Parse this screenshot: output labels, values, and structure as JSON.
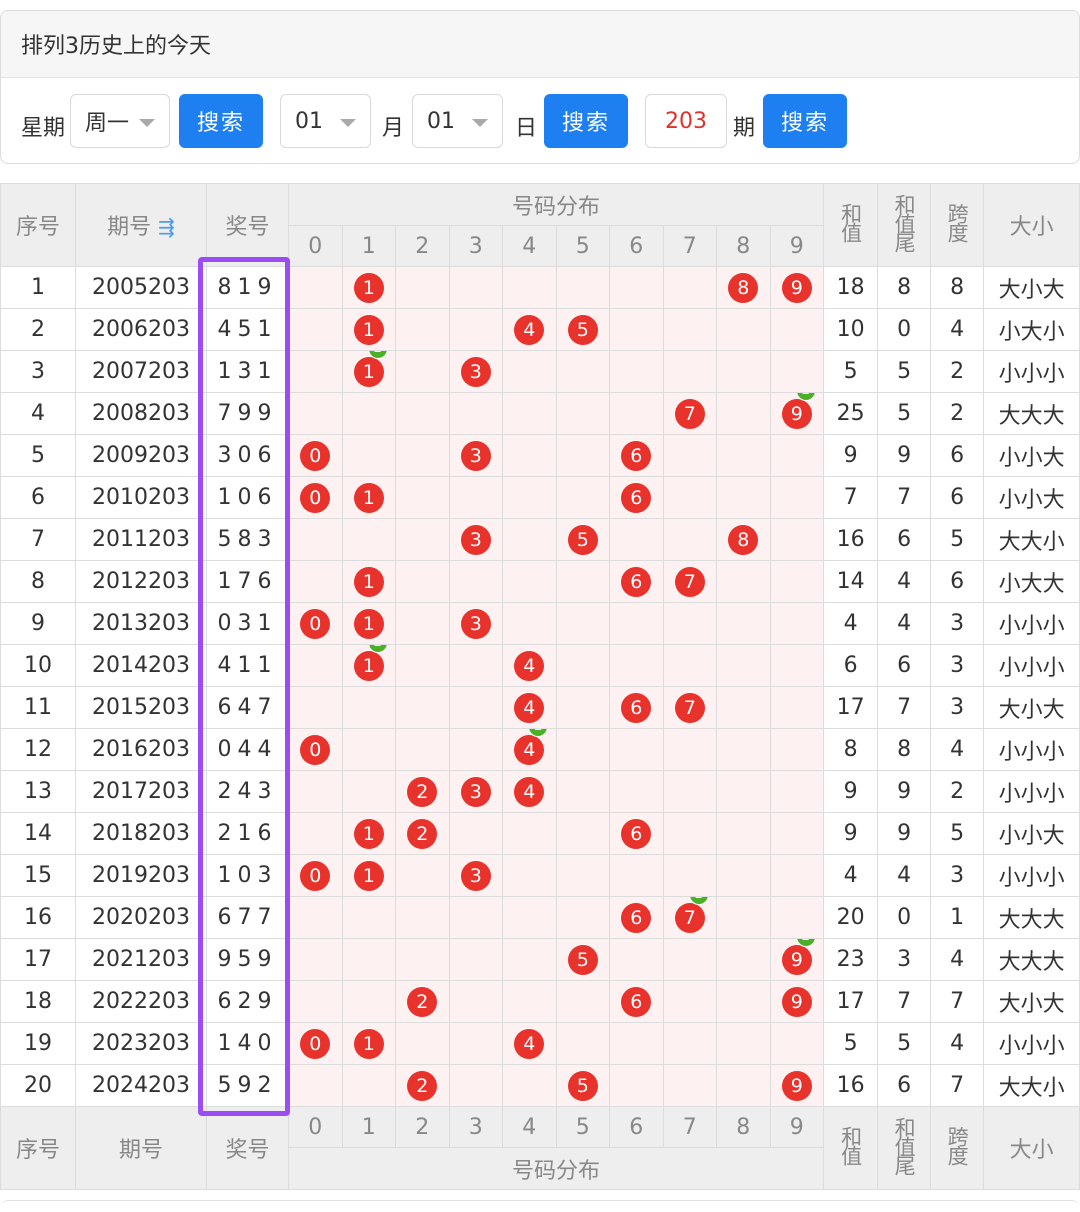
{
  "panel": {
    "title": "排列3历史上的今天",
    "week_label": "星期",
    "week_value": "周一",
    "month_value": "01",
    "month_label": "月",
    "day_value": "01",
    "day_label": "日",
    "issue_value": "203",
    "issue_label": "期",
    "search_label": "搜索"
  },
  "table": {
    "headers": {
      "index": "序号",
      "period": "期号",
      "prize": "奖号",
      "distribution": "号码分布",
      "sum": "和值",
      "sum_tail": "和值尾",
      "span": "跨度",
      "size": "大小"
    },
    "digits": [
      "0",
      "1",
      "2",
      "3",
      "4",
      "5",
      "6",
      "7",
      "8",
      "9"
    ],
    "rows": [
      {
        "idx": "1",
        "period": "2005203",
        "prize": "819",
        "balls": [
          1,
          8,
          9
        ],
        "repeat": null,
        "sum": "18",
        "tail": "8",
        "span": "8",
        "size": "大小大"
      },
      {
        "idx": "2",
        "period": "2006203",
        "prize": "451",
        "balls": [
          1,
          4,
          5
        ],
        "repeat": null,
        "sum": "10",
        "tail": "0",
        "span": "4",
        "size": "小大小"
      },
      {
        "idx": "3",
        "period": "2007203",
        "prize": "131",
        "balls": [
          1,
          3
        ],
        "repeat": 1,
        "sum": "5",
        "tail": "5",
        "span": "2",
        "size": "小小小"
      },
      {
        "idx": "4",
        "period": "2008203",
        "prize": "799",
        "balls": [
          7,
          9
        ],
        "repeat": 9,
        "sum": "25",
        "tail": "5",
        "span": "2",
        "size": "大大大"
      },
      {
        "idx": "5",
        "period": "2009203",
        "prize": "306",
        "balls": [
          0,
          3,
          6
        ],
        "repeat": null,
        "sum": "9",
        "tail": "9",
        "span": "6",
        "size": "小小大"
      },
      {
        "idx": "6",
        "period": "2010203",
        "prize": "106",
        "balls": [
          0,
          1,
          6
        ],
        "repeat": null,
        "sum": "7",
        "tail": "7",
        "span": "6",
        "size": "小小大"
      },
      {
        "idx": "7",
        "period": "2011203",
        "prize": "583",
        "balls": [
          3,
          5,
          8
        ],
        "repeat": null,
        "sum": "16",
        "tail": "6",
        "span": "5",
        "size": "大大小"
      },
      {
        "idx": "8",
        "period": "2012203",
        "prize": "176",
        "balls": [
          1,
          6,
          7
        ],
        "repeat": null,
        "sum": "14",
        "tail": "4",
        "span": "6",
        "size": "小大大"
      },
      {
        "idx": "9",
        "period": "2013203",
        "prize": "031",
        "balls": [
          0,
          1,
          3
        ],
        "repeat": null,
        "sum": "4",
        "tail": "4",
        "span": "3",
        "size": "小小小"
      },
      {
        "idx": "10",
        "period": "2014203",
        "prize": "411",
        "balls": [
          1,
          4
        ],
        "repeat": 1,
        "sum": "6",
        "tail": "6",
        "span": "3",
        "size": "小小小"
      },
      {
        "idx": "11",
        "period": "2015203",
        "prize": "647",
        "balls": [
          4,
          6,
          7
        ],
        "repeat": null,
        "sum": "17",
        "tail": "7",
        "span": "3",
        "size": "大小大"
      },
      {
        "idx": "12",
        "period": "2016203",
        "prize": "044",
        "balls": [
          0,
          4
        ],
        "repeat": 4,
        "sum": "8",
        "tail": "8",
        "span": "4",
        "size": "小小小"
      },
      {
        "idx": "13",
        "period": "2017203",
        "prize": "243",
        "balls": [
          2,
          3,
          4
        ],
        "repeat": null,
        "sum": "9",
        "tail": "9",
        "span": "2",
        "size": "小小小"
      },
      {
        "idx": "14",
        "period": "2018203",
        "prize": "216",
        "balls": [
          1,
          2,
          6
        ],
        "repeat": null,
        "sum": "9",
        "tail": "9",
        "span": "5",
        "size": "小小大"
      },
      {
        "idx": "15",
        "period": "2019203",
        "prize": "103",
        "balls": [
          0,
          1,
          3
        ],
        "repeat": null,
        "sum": "4",
        "tail": "4",
        "span": "3",
        "size": "小小小"
      },
      {
        "idx": "16",
        "period": "2020203",
        "prize": "677",
        "balls": [
          6,
          7
        ],
        "repeat": 7,
        "sum": "20",
        "tail": "0",
        "span": "1",
        "size": "大大大"
      },
      {
        "idx": "17",
        "period": "2021203",
        "prize": "959",
        "balls": [
          5,
          9
        ],
        "repeat": 9,
        "sum": "23",
        "tail": "3",
        "span": "4",
        "size": "大大大"
      },
      {
        "idx": "18",
        "period": "2022203",
        "prize": "629",
        "balls": [
          2,
          6,
          9
        ],
        "repeat": null,
        "sum": "17",
        "tail": "7",
        "span": "7",
        "size": "大小大"
      },
      {
        "idx": "19",
        "period": "2023203",
        "prize": "140",
        "balls": [
          0,
          1,
          4
        ],
        "repeat": null,
        "sum": "5",
        "tail": "5",
        "span": "4",
        "size": "小小小"
      },
      {
        "idx": "20",
        "period": "2024203",
        "prize": "592",
        "balls": [
          2,
          5,
          9
        ],
        "repeat": null,
        "sum": "16",
        "tail": "6",
        "span": "7",
        "size": "大大小"
      }
    ],
    "repeat_badge": "2"
  },
  "colors": {
    "accent": "#1e7ff0",
    "ball": "#e8322c",
    "badge": "#4caf28",
    "highlight": "#9b4cf5"
  }
}
